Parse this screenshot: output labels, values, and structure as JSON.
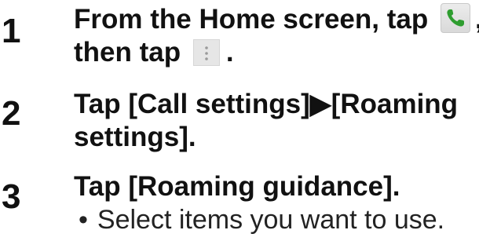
{
  "steps": [
    {
      "number": "1",
      "line1_before_icon": "From the Home screen, tap ",
      "line1_icon": "phone-app-icon",
      "line1_after_icon": ",",
      "line2_before_icon": "then tap ",
      "line2_icon": "menu-icon",
      "line2_after_icon": "."
    },
    {
      "number": "2",
      "line1": "Tap [Call settings]▶[Roaming",
      "line2": "settings]."
    },
    {
      "number": "3",
      "line1": "Tap [Roaming guidance].",
      "bullet_symbol": "•",
      "bullet_text": "Select items you want to use."
    }
  ],
  "colors": {
    "text": "#111111",
    "phone_icon_green": "#2e9d2f",
    "icon_background": "#e6e6e6"
  }
}
